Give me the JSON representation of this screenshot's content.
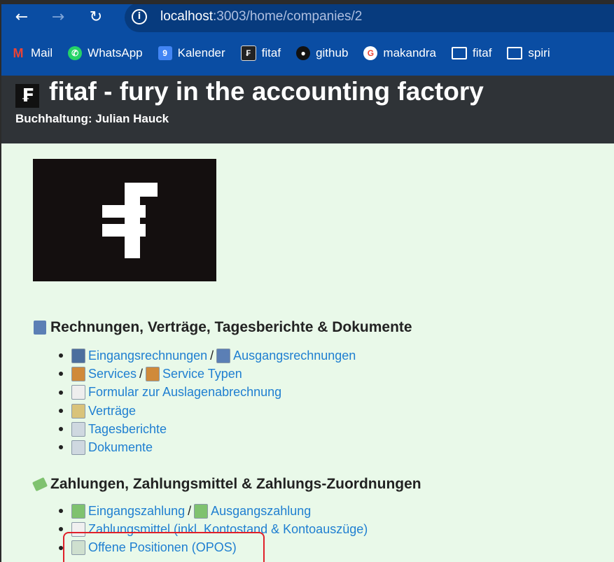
{
  "browser": {
    "url_host": "localhost",
    "url_rest": ":3003/home/companies/2",
    "bookmarks": [
      {
        "label": "Mail",
        "icon": "gmail-icon",
        "glyph": "M"
      },
      {
        "label": "WhatsApp",
        "icon": "whatsapp-icon",
        "glyph": "✆"
      },
      {
        "label": "Kalender",
        "icon": "calendar-icon",
        "glyph": "9"
      },
      {
        "label": "fitaf",
        "icon": "fitaf-icon",
        "glyph": "₣"
      },
      {
        "label": "github",
        "icon": "github-icon",
        "glyph": "●"
      },
      {
        "label": "makandra",
        "icon": "google-icon",
        "glyph": "G"
      },
      {
        "label": "fitaf",
        "icon": "folder-icon",
        "glyph": ""
      },
      {
        "label": "spiri",
        "icon": "folder-icon",
        "glyph": ""
      }
    ]
  },
  "header": {
    "title": "fitaf - fury in the accounting factory",
    "subtitle": "Buchhaltung: Julian Hauck"
  },
  "sections": [
    {
      "title": "Rechnungen, Verträge, Tagesberichte & Dokumente",
      "items": [
        {
          "links": [
            "Eingangsrechnungen",
            "Ausgangsrechnungen"
          ]
        },
        {
          "links": [
            "Services",
            "Service Typen"
          ]
        },
        {
          "links": [
            "Formular zur Auslagenabrechnung"
          ]
        },
        {
          "links": [
            "Verträge"
          ]
        },
        {
          "links": [
            "Tagesberichte"
          ]
        },
        {
          "links": [
            "Dokumente"
          ]
        }
      ]
    },
    {
      "title": "Zahlungen, Zahlungsmittel & Zahlungs-Zuordnungen",
      "items": [
        {
          "links": [
            "Eingangszahlung",
            "Ausgangszahlung"
          ]
        },
        {
          "links": [
            "Zahlungsmittel (inkl. Kontostand & Kontoauszüge)"
          ]
        },
        {
          "links": [
            "Offene Positionen (OPOS)"
          ]
        }
      ]
    }
  ],
  "separator": "/",
  "colors": {
    "link": "#1f7fd1",
    "chrome": "#0a4da3",
    "header": "#2f3337",
    "page_bg": "#e9f9e9",
    "highlight": "#e0202a"
  }
}
